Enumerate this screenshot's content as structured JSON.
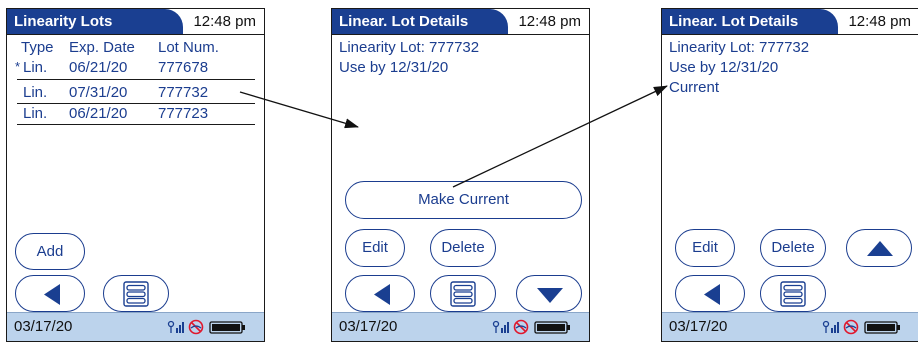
{
  "colors": {
    "title_bg": "#1a3f91",
    "text": "#1b3d8f",
    "status_bg": "#bcd3ec"
  },
  "screen1": {
    "title": "Linearity Lots",
    "time": "12:48 pm",
    "headers": {
      "type": "Type",
      "exp": "Exp. Date",
      "lot": "Lot Num."
    },
    "rows": [
      {
        "marker": "*",
        "type": "Lin.",
        "exp": "06/21/20",
        "lot": "777678"
      },
      {
        "marker": "",
        "type": "Lin.",
        "exp": "07/31/20",
        "lot": "777732"
      },
      {
        "marker": "",
        "type": "Lin.",
        "exp": "06/21/20",
        "lot": "777723"
      }
    ],
    "add_label": "Add",
    "date": "03/17/20"
  },
  "screen2": {
    "title": "Linear. Lot Details",
    "time": "12:48 pm",
    "line1": "Linearity Lot: 777732",
    "line2": "Use by 12/31/20",
    "make_current_label": "Make Current",
    "edit_label": "Edit",
    "delete_label": "Delete",
    "date": "03/17/20"
  },
  "screen3": {
    "title": "Linear. Lot Details",
    "time": "12:48 pm",
    "line1": "Linearity Lot: 777732",
    "line2": "Use by 12/31/20",
    "line3": "Current",
    "edit_label": "Edit",
    "delete_label": "Delete",
    "date": "03/17/20"
  },
  "icons": [
    "back-arrow-icon",
    "menu-icon",
    "down-arrow-icon",
    "up-arrow-icon",
    "signal-icon",
    "wifi-off-icon",
    "battery-icon"
  ]
}
